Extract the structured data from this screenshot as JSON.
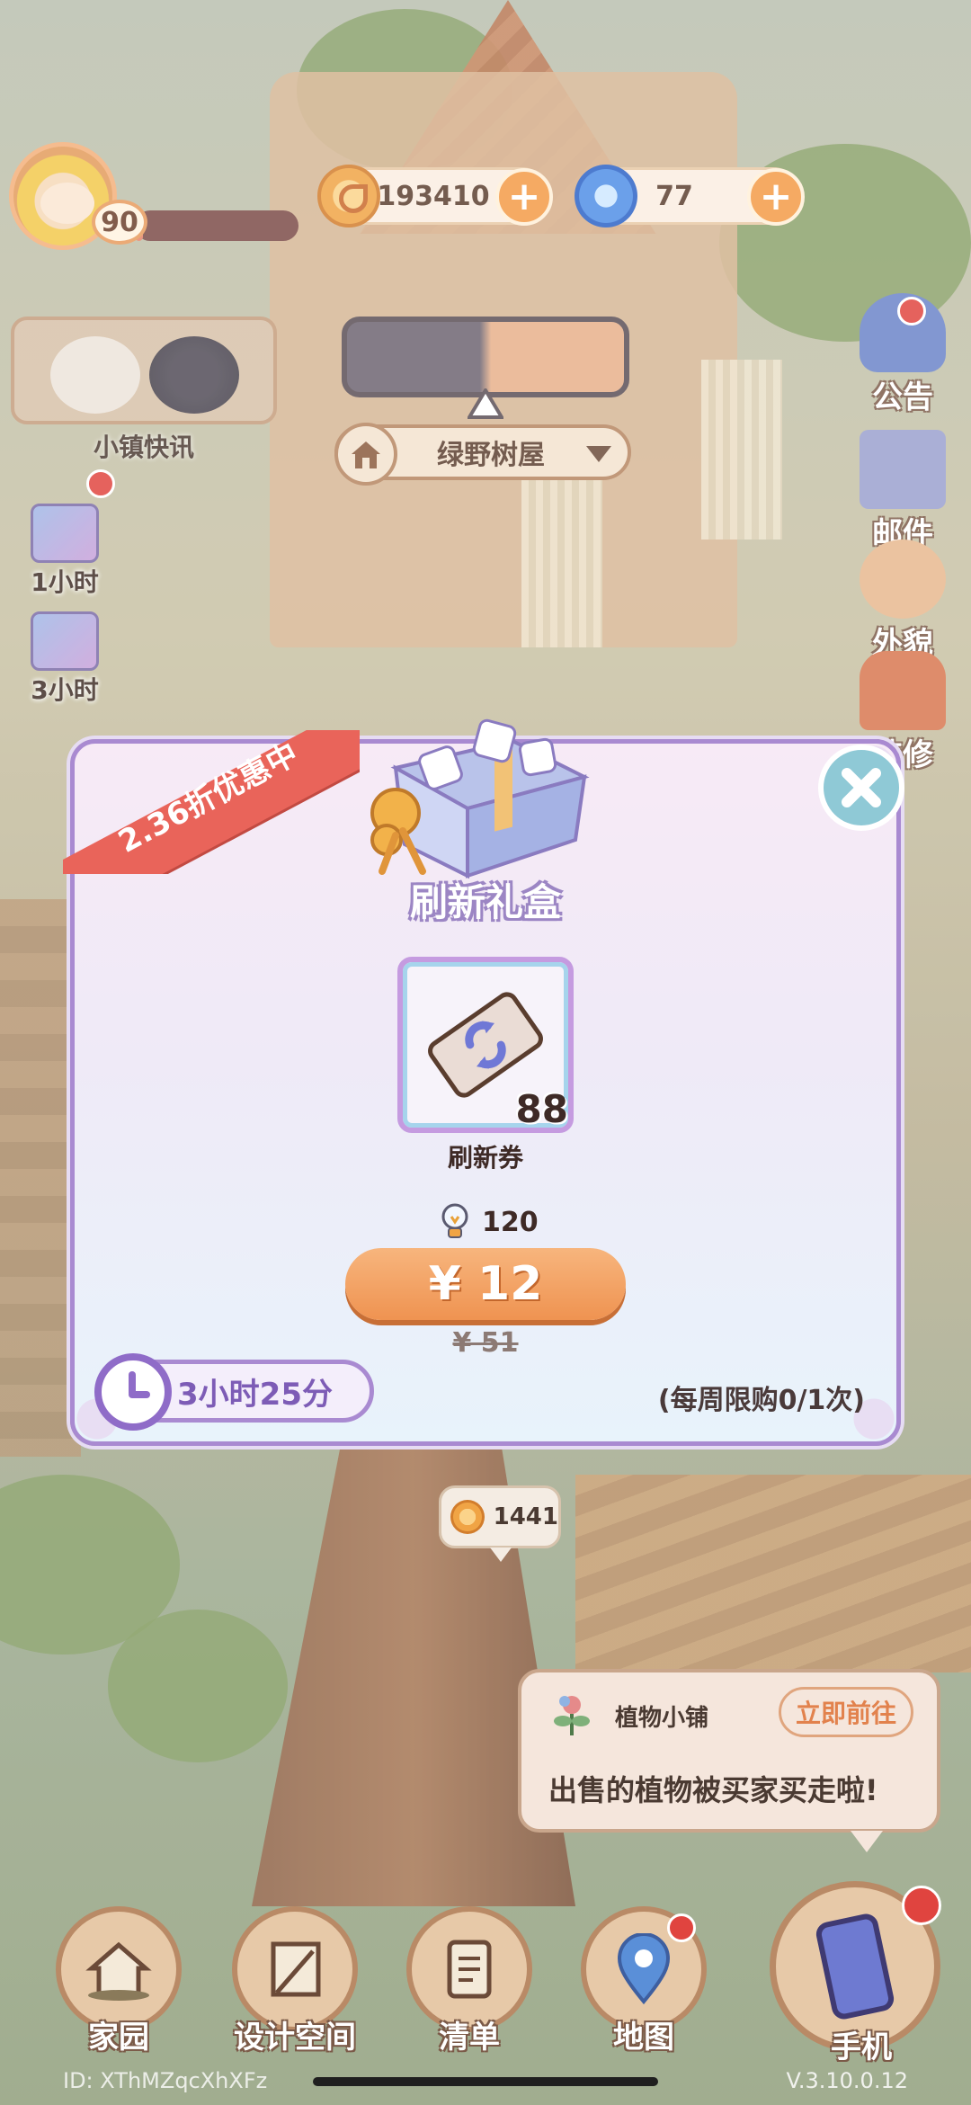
{
  "hud": {
    "level": "90",
    "xp_fraction": 0.05,
    "coins": "193410",
    "gems": "77",
    "news_label": "小镇快讯",
    "location_name": "绿野树屋",
    "left_timers": [
      {
        "label": "1小时",
        "icon": "gift-box-icon"
      },
      {
        "label": "3小时",
        "icon": "gift-box-icon"
      }
    ],
    "right_menu": [
      {
        "label": "公告",
        "icon": "announcement-icon"
      },
      {
        "label": "邮件",
        "icon": "mail-icon"
      },
      {
        "label": "外貌",
        "icon": "appearance-icon"
      },
      {
        "label": "装修",
        "icon": "decorate-icon"
      }
    ]
  },
  "offer": {
    "ribbon": "2.36折优惠中",
    "title": "刷新礼盒",
    "item_name": "刷新券",
    "item_count": "88",
    "bonus_amount": "120",
    "price": "¥ 12",
    "original_price": "¥ 51",
    "timer": "3小时25分",
    "limit": "(每周限购0/1次)"
  },
  "scene": {
    "coin_bubble": "1441"
  },
  "shop_notice": {
    "title": "植物小铺",
    "goto_label": "立即前往",
    "message": "出售的植物被买家买走啦!"
  },
  "nav": [
    {
      "label": "家园",
      "icon": "home-icon"
    },
    {
      "label": "设计空间",
      "icon": "design-icon"
    },
    {
      "label": "清单",
      "icon": "list-icon"
    },
    {
      "label": "地图",
      "icon": "map-icon"
    },
    {
      "label": "手机",
      "icon": "phone-icon"
    }
  ],
  "footer": {
    "id_text": "ID: XThMZqcXhXFz",
    "version": "V.3.10.0.12"
  },
  "colors": {
    "accent_orange": "#ef9351",
    "modal_border": "#a98ad1",
    "ribbon_red": "#e9645a",
    "notify_red": "#e0443f"
  }
}
